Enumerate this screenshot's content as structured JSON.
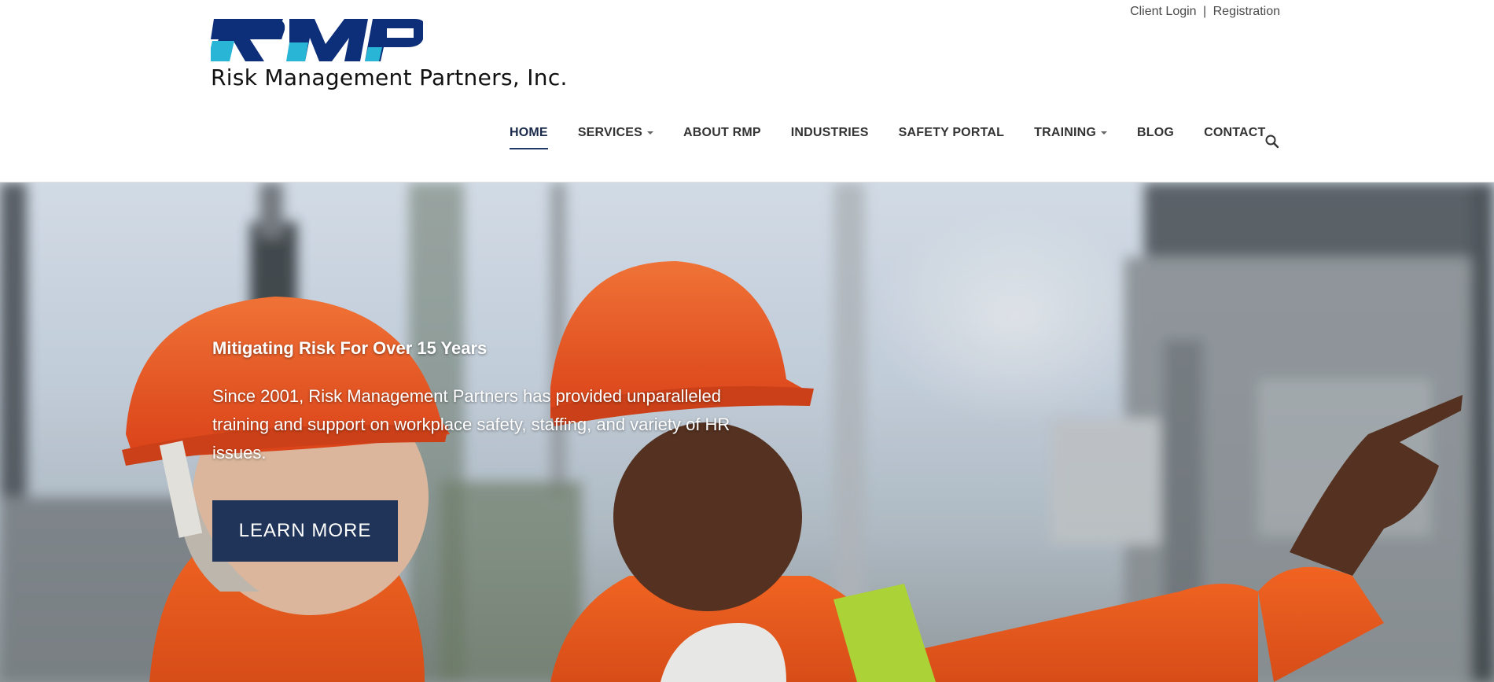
{
  "header": {
    "top_links": {
      "login": "Client Login",
      "separator": "|",
      "registration": "Registration"
    },
    "logo": {
      "mark": "RMP",
      "caption": "Risk Management Partners, Inc."
    }
  },
  "nav": {
    "items": [
      {
        "label": "HOME",
        "active": true
      },
      {
        "label": "SERVICES",
        "dropdown": true
      },
      {
        "label": "ABOUT RMP"
      },
      {
        "label": "INDUSTRIES"
      },
      {
        "label": "SAFETY PORTAL"
      },
      {
        "label": "TRAINING",
        "dropdown": true
      },
      {
        "label": "BLOG"
      },
      {
        "label": "CONTACT"
      }
    ],
    "search_icon": "search-icon"
  },
  "hero": {
    "kicker": "Mitigating Risk For Over 15 Years",
    "body": "Since 2001, Risk Management Partners has provided unparalleled training and support on workplace safety, staffing, and variety of HR issues.",
    "cta_label": "LEARN MORE"
  },
  "colors": {
    "brand_navy": "#1f3458",
    "brand_cyan": "#29b6d6",
    "logo_blue": "#0d2f7a",
    "hardhat_orange": "#f05a1e"
  }
}
